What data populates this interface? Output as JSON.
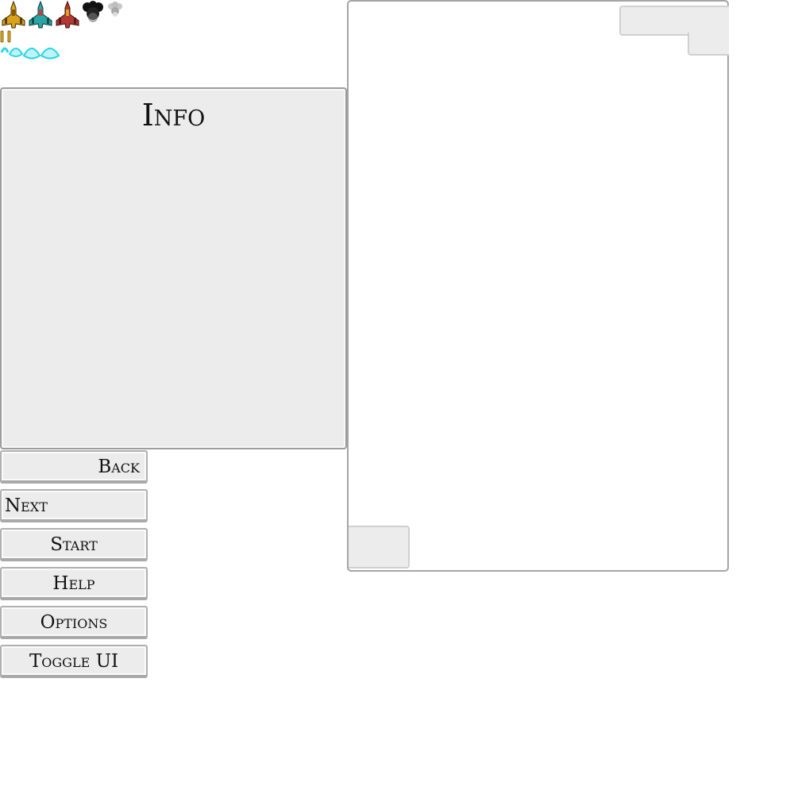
{
  "info_panel": {
    "title": "Info"
  },
  "menu": {
    "back_label": "Back",
    "next_label": "Next",
    "start_label": "Start",
    "help_label": "Help",
    "options_label": "Options",
    "toggle_ui_label": "Toggle UI"
  },
  "sprites": {
    "items": [
      "yellow-fighter-ship-icon",
      "teal-fighter-ship-icon",
      "red-fighter-ship-icon",
      "black-enemy-blob-icon",
      "gray-enemy-blob-icon",
      "bullet-icon",
      "wave-shot-icon"
    ]
  },
  "colors": {
    "panel_bg": "#ececec",
    "panel_border": "#9c9c9c",
    "viewport_border": "#a5a5a5",
    "wave_cyan": "#27d6e6"
  }
}
